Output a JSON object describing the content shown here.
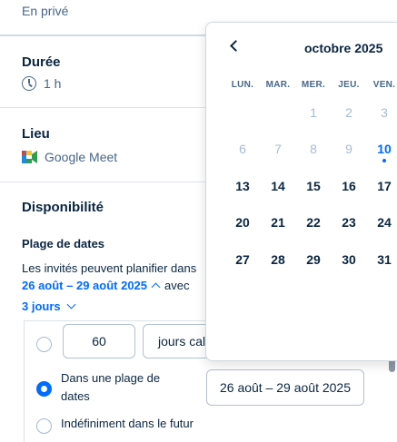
{
  "header": {
    "privacy_label": "En privé"
  },
  "duration": {
    "title": "Durée",
    "value": "1 h",
    "icon": "clock-icon"
  },
  "location": {
    "title": "Lieu",
    "value": "Google Meet",
    "icon": "google-meet-icon"
  },
  "availability": {
    "title": "Disponibilité",
    "date_range": {
      "heading": "Plage de dates",
      "description": "Les invités peuvent planifier dans",
      "range_link": "26 août – 29 août 2025",
      "after_text": "avec",
      "days_link": "3 jours"
    },
    "options": {
      "rolling_days_value": "60",
      "rolling_unit": "jours calendaires",
      "in_range_label_line1": "Dans une plage de",
      "in_range_label_line2": "dates",
      "in_range_value": "26 août – 29 août 2025",
      "indefinite_label": "Indéfiniment dans le futur",
      "selected": "in_range"
    }
  },
  "calendar": {
    "month_label": "octobre 2025",
    "weekdays": [
      "LUN.",
      "MAR.",
      "MER.",
      "JEU.",
      "VEN."
    ],
    "weeks": [
      [
        "",
        "",
        "1",
        "2",
        "3"
      ],
      [
        "6",
        "7",
        "8",
        "9",
        "10"
      ],
      [
        "13",
        "14",
        "15",
        "16",
        "17"
      ],
      [
        "20",
        "21",
        "22",
        "23",
        "24"
      ],
      [
        "27",
        "28",
        "29",
        "30",
        "31"
      ]
    ],
    "unavailable_days": [
      "1",
      "2",
      "3",
      "6",
      "7",
      "8",
      "9"
    ],
    "today": "10"
  },
  "colors": {
    "accent": "#006bff",
    "text": "#0a2540",
    "muted": "#476788"
  }
}
